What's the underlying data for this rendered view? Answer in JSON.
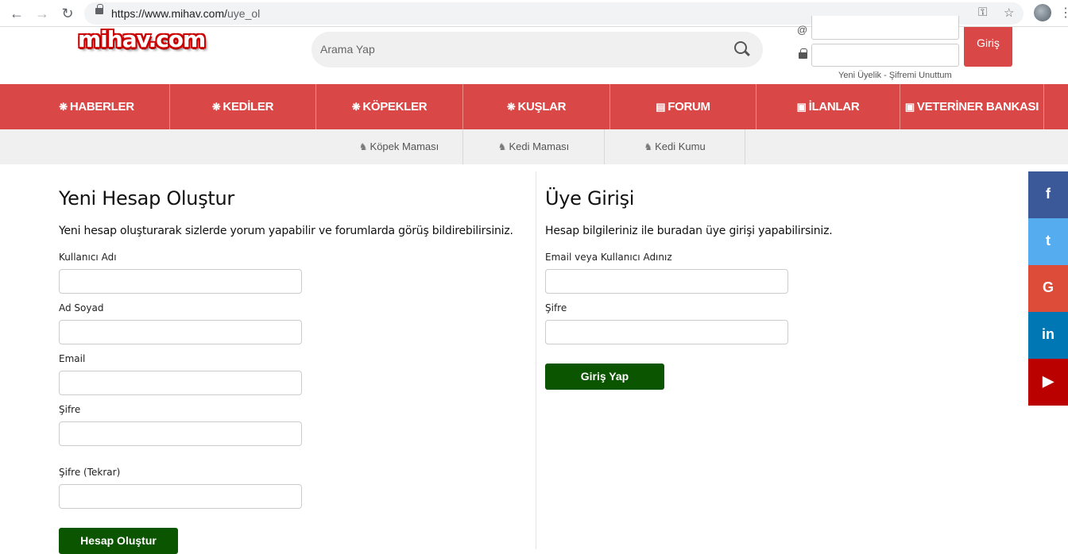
{
  "browser": {
    "url_host": "https://www.mihav.com/",
    "url_path": "uye_ol",
    "back": "←",
    "forward": "→",
    "reload": "↻",
    "key": "⚿",
    "star": "☆",
    "dots": "⋮"
  },
  "site": {
    "logo": "mihav.com",
    "search_placeholder": "Arama Yap",
    "login_button": "Giriş",
    "register_link": "Yeni Üyelik",
    "separator": "-",
    "forgot_link": "Şifremi Unuttum",
    "at_symbol": "@"
  },
  "main_nav": [
    {
      "icon": "paw-icon",
      "glyph": "❋",
      "label": "HABERLER"
    },
    {
      "icon": "paw-icon",
      "glyph": "❋",
      "label": "KEDİLER"
    },
    {
      "icon": "paw-icon",
      "glyph": "❋",
      "label": "KÖPEKLER"
    },
    {
      "icon": "paw-icon",
      "glyph": "❋",
      "label": "KUŞLAR"
    },
    {
      "icon": "forum-icon",
      "glyph": "▤",
      "label": "FORUM"
    },
    {
      "icon": "listing-icon",
      "glyph": "▣",
      "label": "İLANLAR"
    },
    {
      "icon": "book-icon",
      "glyph": "▣",
      "label": "VETERİNER BANKASI"
    }
  ],
  "sub_nav": [
    {
      "icon": "dog-icon",
      "glyph": "♞",
      "label": "Köpek Maması"
    },
    {
      "icon": "cat-icon",
      "glyph": "♞",
      "label": "Kedi Maması"
    },
    {
      "icon": "cat-icon",
      "glyph": "♞",
      "label": "Kedi Kumu"
    }
  ],
  "register": {
    "title": "Yeni Hesap Oluştur",
    "lead": "Yeni hesap oluşturarak sizlerde yorum yapabilir ve forumlarda görüş bildirebilirsiniz.",
    "fields": [
      "Kullanıcı Adı",
      "Ad Soyad",
      "Email",
      "Şifre",
      "Şifre (Tekrar)"
    ],
    "button": "Hesap Oluştur"
  },
  "login": {
    "title": "Üye Girişi",
    "lead": "Hesap bilgileriniz ile buradan üye girişi yapabilirsiniz.",
    "fields": [
      "Email veya Kullanıcı Adınız",
      "Şifre"
    ],
    "button": "Giriş Yap"
  },
  "social": [
    {
      "name": "facebook-icon",
      "glyph": "f",
      "color": "#3b5998"
    },
    {
      "name": "twitter-icon",
      "glyph": "t",
      "color": "#55acee"
    },
    {
      "name": "google-icon",
      "glyph": "G",
      "color": "#dd4b39"
    },
    {
      "name": "linkedin-icon",
      "glyph": "in",
      "color": "#0077b5"
    },
    {
      "name": "youtube-icon",
      "glyph": "▶",
      "color": "#bb0000"
    }
  ]
}
